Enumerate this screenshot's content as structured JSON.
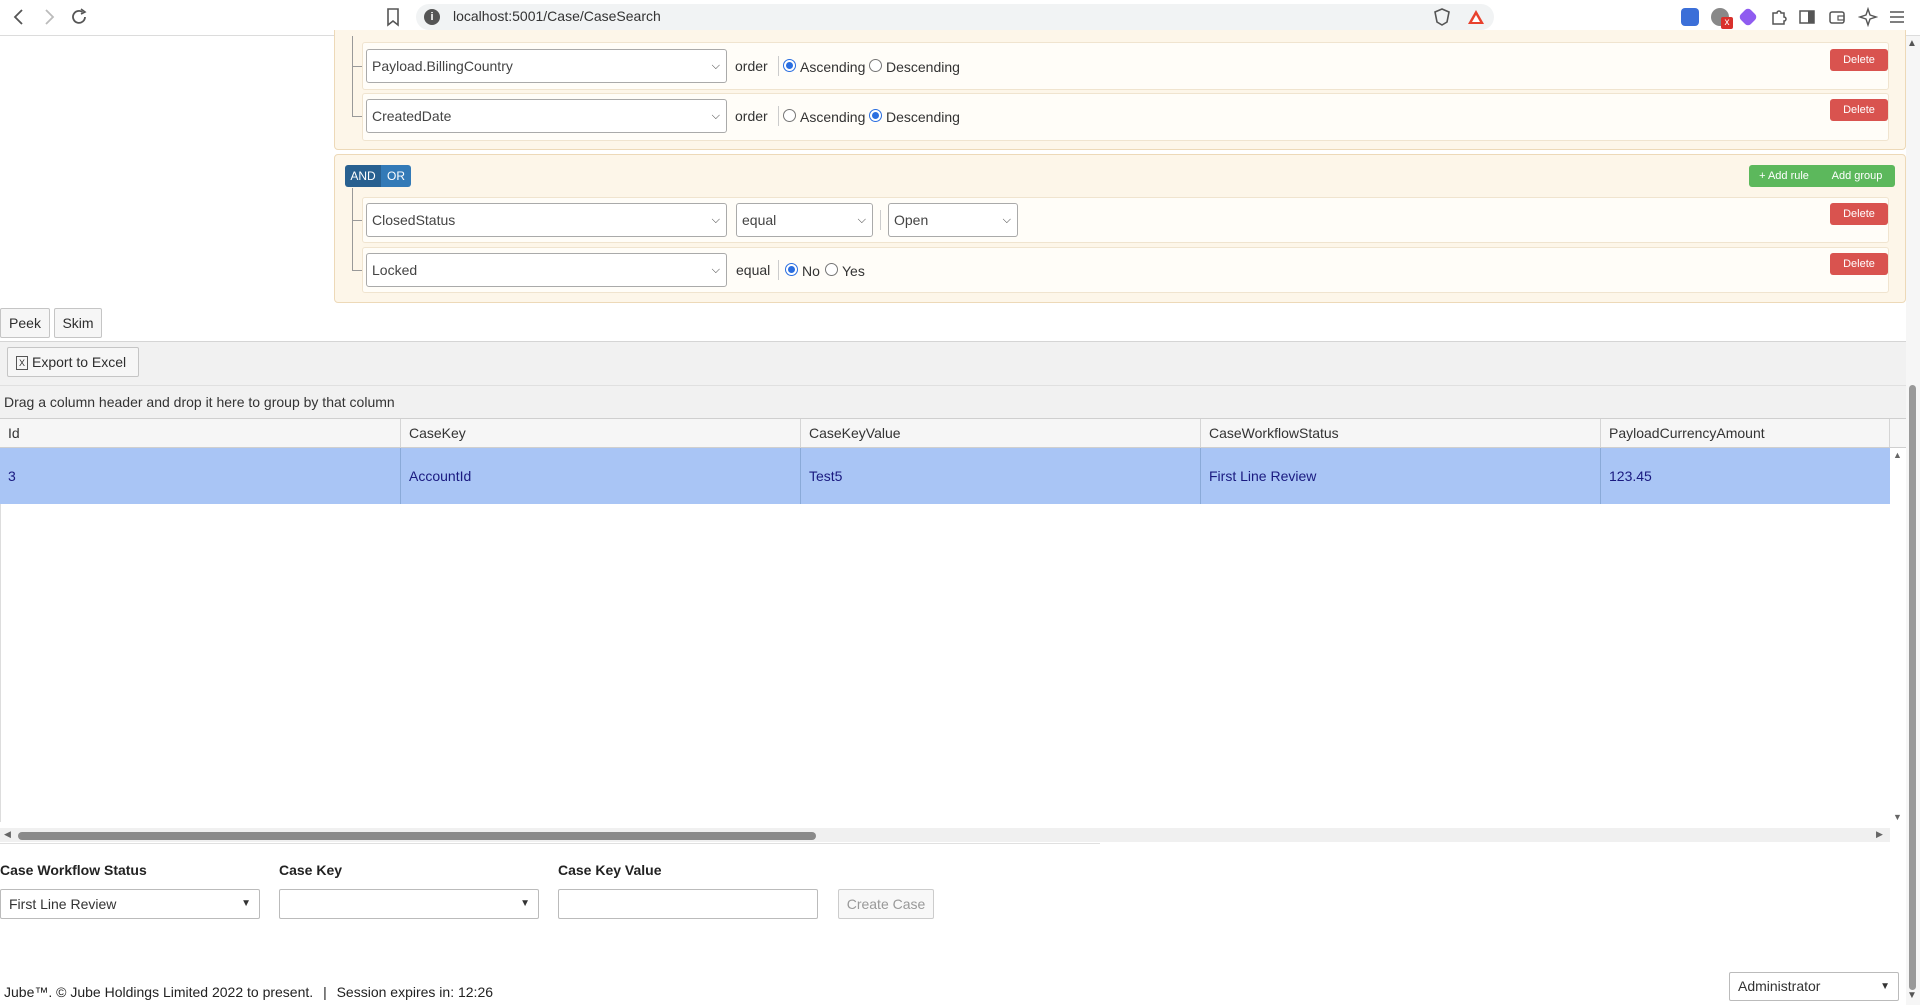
{
  "browser": {
    "url": "localhost:5001/Case/CaseSearch",
    "icons": [
      "back-icon",
      "forward-icon",
      "reload-icon",
      "bookmark-icon",
      "site-info-icon",
      "brave-shield-icon",
      "brave-rewards-icon",
      "extension-icon",
      "extension-icon",
      "extension-icon",
      "puzzle-icon",
      "sidebar-icon",
      "wallet-icon",
      "leo-icon",
      "menu-icon"
    ]
  },
  "query_builder": {
    "sort_rules": [
      {
        "field": "Payload.BillingCountry",
        "order_label": "order",
        "ascending_label": "Ascending",
        "descending_label": "Descending",
        "selected": "ascending",
        "delete_label": "Delete"
      },
      {
        "field": "CreatedDate",
        "order_label": "order",
        "ascending_label": "Ascending",
        "descending_label": "Descending",
        "selected": "descending",
        "delete_label": "Delete"
      }
    ],
    "filter_group": {
      "and_label": "AND",
      "or_label": "OR",
      "add_rule_label": "+ Add rule",
      "add_group_label": "Add group",
      "rules": [
        {
          "field": "ClosedStatus",
          "operator": "equal",
          "value": "Open",
          "delete_label": "Delete"
        },
        {
          "field": "Locked",
          "operator": "equal",
          "no_label": "No",
          "yes_label": "Yes",
          "selected": "no",
          "delete_label": "Delete"
        }
      ]
    }
  },
  "actions": {
    "peek_label": "Peek",
    "skim_label": "Skim"
  },
  "grid": {
    "export_label": "Export to Excel",
    "grouping_hint": "Drag a column header and drop it here to group by that column",
    "columns": [
      "Id",
      "CaseKey",
      "CaseKeyValue",
      "CaseWorkflowStatus",
      "PayloadCurrencyAmount"
    ],
    "rows": [
      [
        "3",
        "AccountId",
        "Test5",
        "First Line Review",
        "123.45"
      ]
    ],
    "selected_row_color": "#a9c5f5"
  },
  "create_form": {
    "workflow_status_label": "Case Workflow Status",
    "workflow_status_value": "First Line Review",
    "case_key_label": "Case Key",
    "case_key_value": "",
    "case_key_value_label": "Case Key Value",
    "case_key_value_input": "",
    "create_label": "Create Case"
  },
  "footer": {
    "copyright": "Jube™. © Jube Holdings Limited 2022 to present.",
    "separator": "|",
    "session": "Session expires in: 12:26",
    "user_role": "Administrator"
  }
}
